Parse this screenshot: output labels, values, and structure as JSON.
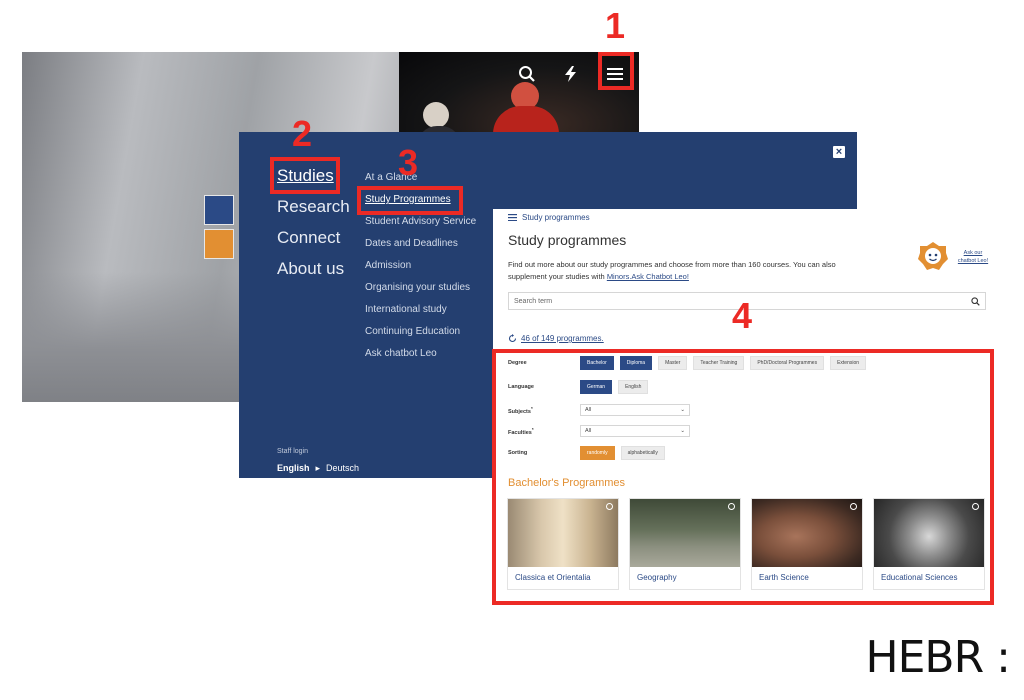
{
  "annotations": {
    "n1": "1",
    "n2": "2",
    "n3": "3",
    "n4": "4"
  },
  "hero": {
    "icons": [
      "search-icon",
      "lightning-icon",
      "hamburger-menu-icon"
    ]
  },
  "nav_panel": {
    "close_label": "×",
    "main_items": [
      "Studies",
      "Research",
      "Connect",
      "About us"
    ],
    "sub_items": [
      "At a Glance",
      "Study Programmes",
      "Student Advisory Service",
      "Dates and Deadlines",
      "Admission",
      "Organising your studies",
      "International study",
      "Continuing Education",
      "Ask chatbot Leo"
    ],
    "staff_login": "Staff login",
    "lang_en": "English",
    "lang_de": "Deutsch"
  },
  "study_page": {
    "breadcrumb": "Study programmes",
    "title": "Study programmes",
    "intro": "Find out more about our study programmes and choose from more than 160 courses. You can also supplement your studies with ",
    "intro_link": "Minors.Ask Chatbot Leo!",
    "leo_link": "Ask our chatbot Leo!",
    "search_placeholder": "Search term",
    "count": "46 of 149 programmes.",
    "filters": {
      "degree_label": "Degree",
      "degree_options": [
        "Bachelor",
        "Diploma",
        "Master",
        "Teacher Training",
        "PhD/Doctoral Programmes",
        "Extension"
      ],
      "language_label": "Language",
      "language_options": [
        "German",
        "English"
      ],
      "subjects_label": "Subjects",
      "subjects_value": "All",
      "faculties_label": "Faculties",
      "faculties_value": "All",
      "sorting_label": "Sorting",
      "sorting_options": [
        "randomly",
        "alphabetically"
      ]
    },
    "section_title": "Bachelor's Programmes",
    "cards": [
      "Classica et Orientalia",
      "Geography",
      "Earth Science",
      "Educational Sciences"
    ]
  },
  "brand": "HEBR :",
  "colors": {
    "annotation_red": "#ec2a25",
    "uni_blue": "#243f70",
    "link_blue": "#2b4a86",
    "accent_orange": "#e28f32"
  }
}
